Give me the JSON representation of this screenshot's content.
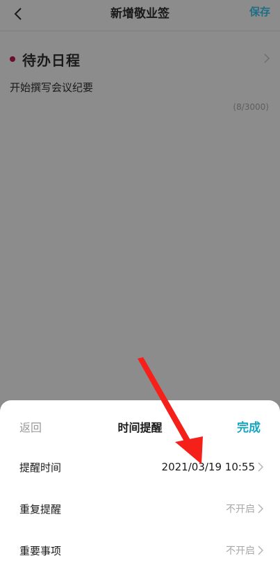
{
  "header": {
    "title": "新增敬业签",
    "save_label": "保存"
  },
  "category": {
    "label": "待办日程",
    "dot_color": "#6a0d2f"
  },
  "note": {
    "text": "开始撰写会议纪要",
    "char_count": "(8/3000)"
  },
  "sheet": {
    "back_label": "返回",
    "title": "时间提醒",
    "done_label": "完成",
    "rows": [
      {
        "label": "提醒时间",
        "value": "2021/03/19 10:55"
      },
      {
        "label": "重复提醒",
        "value": "不开启"
      },
      {
        "label": "重要事项",
        "value": "不开启"
      }
    ]
  },
  "colors": {
    "accent": "#16a6c0",
    "annotation": "#f5201a"
  }
}
